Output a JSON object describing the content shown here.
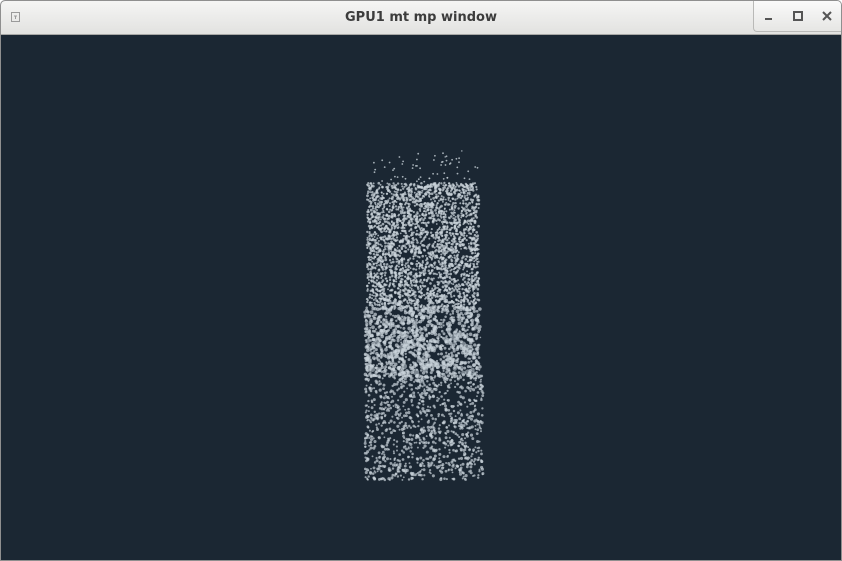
{
  "window": {
    "title": "GPU1 mt mp window"
  },
  "icons": {
    "app": "app-menu-icon",
    "minimize": "minimize-icon",
    "maximize": "maximize-icon",
    "close": "close-icon"
  },
  "colors": {
    "background": "#1b2733",
    "particle": "#c9d3da",
    "titlebar": "#e8e8e6"
  }
}
